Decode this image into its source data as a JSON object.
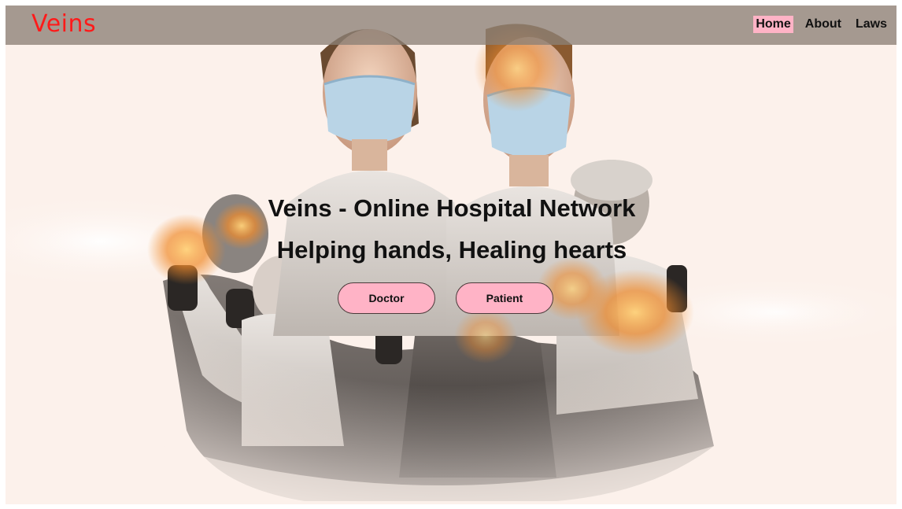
{
  "brand": {
    "name": "Veins",
    "color": "#ff1a1a"
  },
  "nav": {
    "items": [
      {
        "label": "Home",
        "active": true
      },
      {
        "label": "About",
        "active": false
      },
      {
        "label": "Laws",
        "active": false
      }
    ],
    "active_highlight": "#ffb3c6"
  },
  "hero": {
    "title": "Veins - Online Hospital Network",
    "tagline": "Helping hands, Healing hearts",
    "buttons": {
      "doctor_label": "Doctor",
      "patient_label": "Patient"
    },
    "button_color": "#ffb3c6",
    "image": "medical-staff-masks-photo"
  }
}
